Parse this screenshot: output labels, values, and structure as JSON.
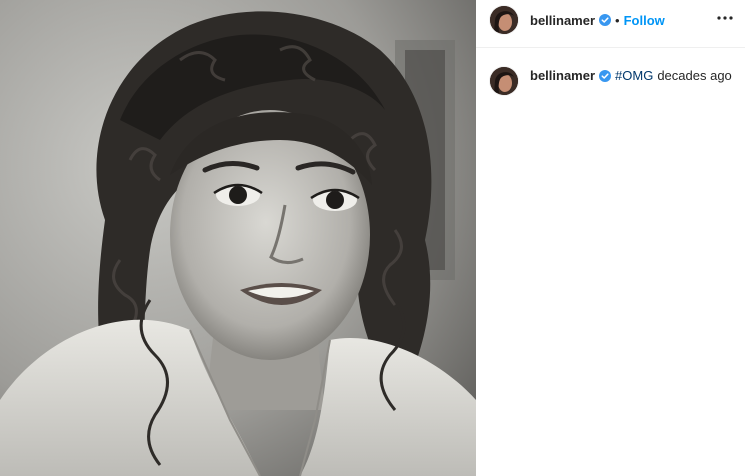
{
  "post": {
    "username": "bellinamer",
    "verified": true,
    "separator": "•",
    "follow_label": "Follow",
    "more_icon": "more-horizontal-icon"
  },
  "caption": {
    "username": "bellinamer",
    "hashtag": "#OMG",
    "text": "decades ago"
  },
  "colors": {
    "link_blue": "#0095f6",
    "hashtag": "#00376b",
    "verified_badge": "#3897f0",
    "text": "#262626"
  }
}
